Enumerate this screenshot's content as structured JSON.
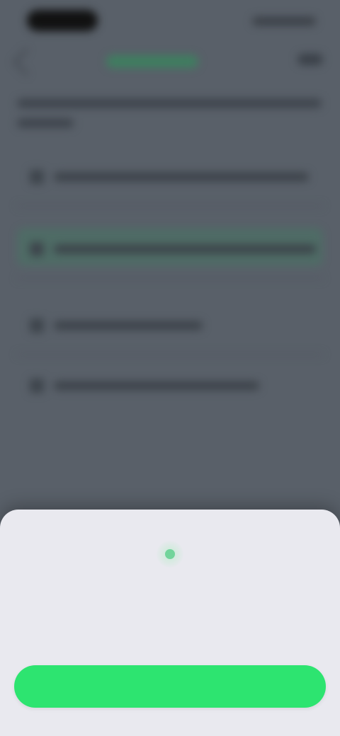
{
  "sheet": {
    "title": "",
    "message": "",
    "button_label": ""
  },
  "colors": {
    "accent": "#2de470",
    "overlay": "#596069",
    "sheet_bg": "#e9e9ef"
  },
  "icons": {
    "status": "check-icon",
    "back": "back-arrow-icon",
    "more": "more-icon"
  }
}
